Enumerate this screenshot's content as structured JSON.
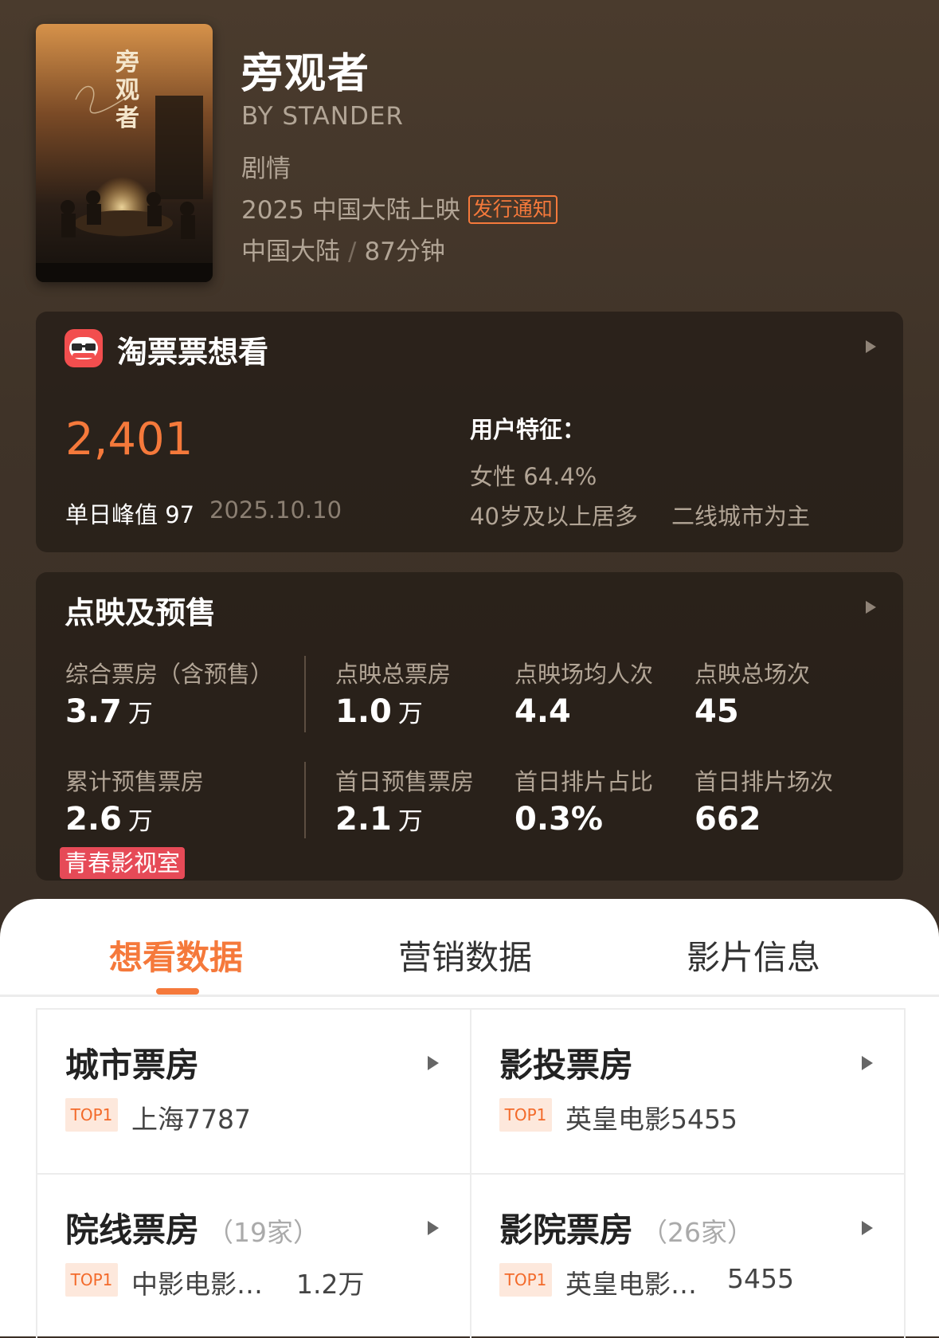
{
  "movie": {
    "title": "旁观者",
    "english_title": "BY STANDER",
    "genre": "剧情",
    "release": "2025 中国大陆上映",
    "release_badge": "发行通知",
    "region": "中国大陆",
    "separator": "/",
    "duration": "87分钟",
    "poster_title": "旁观者"
  },
  "want_to_see": {
    "app_name": "淘票票想看",
    "count": "2,401",
    "peak_label": "单日峰值 97",
    "peak_date": "2025.10.10",
    "features_title": "用户特征：",
    "gender": "女性 64.4%",
    "age": "40岁及以上居多",
    "city": "二线城市为主"
  },
  "presale": {
    "title": "点映及预售",
    "tag": "青春影视室",
    "stats": [
      {
        "label": "综合票房（含预售）",
        "value": "3.7",
        "unit": "万"
      },
      {
        "label": "点映总票房",
        "value": "1.0",
        "unit": "万"
      },
      {
        "label": "点映场均人次",
        "value": "4.4",
        "unit": ""
      },
      {
        "label": "点映总场次",
        "value": "45",
        "unit": ""
      },
      {
        "label": "累计预售票房",
        "value": "2.6",
        "unit": "万"
      },
      {
        "label": "首日预售票房",
        "value": "2.1",
        "unit": "万"
      },
      {
        "label": "首日排片占比",
        "value": "0.3%",
        "unit": ""
      },
      {
        "label": "首日排片场次",
        "value": "662",
        "unit": ""
      }
    ]
  },
  "tabs": [
    {
      "label": "想看数据"
    },
    {
      "label": "营销数据"
    },
    {
      "label": "影片信息"
    }
  ],
  "grid": [
    {
      "title": "城市票房",
      "count": "",
      "badge": "TOP1",
      "name": "上海7787",
      "value": ""
    },
    {
      "title": "影投票房",
      "count": "",
      "badge": "TOP1",
      "name": "英皇电影5455",
      "value": ""
    },
    {
      "title": "院线票房",
      "count": "（19家）",
      "badge": "TOP1",
      "name": "中影电影…",
      "value": "1.2万"
    },
    {
      "title": "影院票房",
      "count": "（26家）",
      "badge": "TOP1",
      "name": "英皇电影…",
      "value": "5455"
    }
  ],
  "colors": {
    "accent": "#f5793b",
    "tag_red": "#e64a57",
    "app_icon": "#f24e4e"
  }
}
